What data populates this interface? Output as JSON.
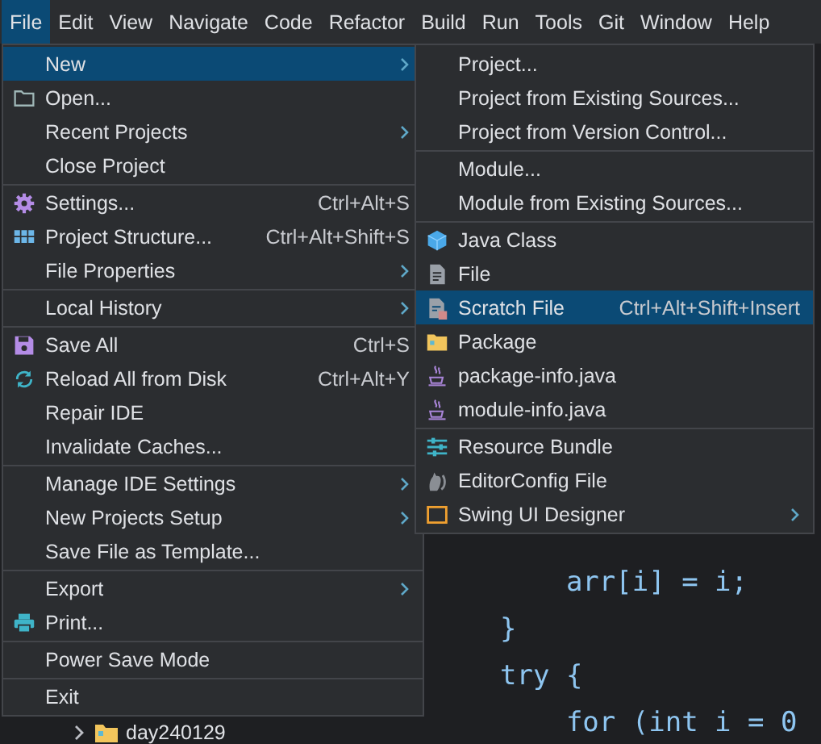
{
  "menubar": [
    {
      "label": "File",
      "selected": true
    },
    {
      "label": "Edit",
      "selected": false
    },
    {
      "label": "View",
      "selected": false
    },
    {
      "label": "Navigate",
      "selected": false
    },
    {
      "label": "Code",
      "selected": false
    },
    {
      "label": "Refactor",
      "selected": false
    },
    {
      "label": "Build",
      "selected": false
    },
    {
      "label": "Run",
      "selected": false
    },
    {
      "label": "Tools",
      "selected": false
    },
    {
      "label": "Git",
      "selected": false
    },
    {
      "label": "Window",
      "selected": false
    },
    {
      "label": "Help",
      "selected": false
    }
  ],
  "file_menu": {
    "groups": [
      {
        "items": [
          {
            "label": "New",
            "submenu": true,
            "selected": true
          },
          {
            "label": "Open...",
            "submenu": false,
            "selected": false
          },
          {
            "label": "Recent Projects",
            "submenu": true,
            "selected": false
          },
          {
            "label": "Close Project",
            "submenu": false,
            "selected": false
          }
        ]
      },
      {
        "items": [
          {
            "label": "Settings...",
            "shortcut": "Ctrl+Alt+S",
            "submenu": false,
            "selected": false
          },
          {
            "label": "Project Structure...",
            "shortcut": "Ctrl+Alt+Shift+S",
            "submenu": false,
            "selected": false
          },
          {
            "label": "File Properties",
            "submenu": true,
            "selected": false
          }
        ]
      },
      {
        "items": [
          {
            "label": "Local History",
            "submenu": true,
            "selected": false
          }
        ]
      },
      {
        "items": [
          {
            "label": "Save All",
            "shortcut": "Ctrl+S",
            "submenu": false,
            "selected": false
          },
          {
            "label": "Reload All from Disk",
            "shortcut": "Ctrl+Alt+Y",
            "submenu": false,
            "selected": false
          },
          {
            "label": "Repair IDE",
            "submenu": false,
            "selected": false
          },
          {
            "label": "Invalidate Caches...",
            "submenu": false,
            "selected": false
          }
        ]
      },
      {
        "items": [
          {
            "label": "Manage IDE Settings",
            "submenu": true,
            "selected": false
          },
          {
            "label": "New Projects Setup",
            "submenu": true,
            "selected": false
          },
          {
            "label": "Save File as Template...",
            "submenu": false,
            "selected": false
          }
        ]
      },
      {
        "items": [
          {
            "label": "Export",
            "submenu": true,
            "selected": false
          },
          {
            "label": "Print...",
            "submenu": false,
            "selected": false
          }
        ]
      },
      {
        "items": [
          {
            "label": "Power Save Mode",
            "submenu": false,
            "selected": false
          }
        ]
      },
      {
        "items": [
          {
            "label": "Exit",
            "submenu": false,
            "selected": false
          }
        ]
      }
    ]
  },
  "new_submenu": {
    "groups": [
      {
        "items": [
          {
            "label": "Project...",
            "submenu": false,
            "selected": false
          },
          {
            "label": "Project from Existing Sources...",
            "submenu": false,
            "selected": false
          },
          {
            "label": "Project from Version Control...",
            "submenu": false,
            "selected": false
          }
        ]
      },
      {
        "items": [
          {
            "label": "Module...",
            "submenu": false,
            "selected": false
          },
          {
            "label": "Module from Existing Sources...",
            "submenu": false,
            "selected": false
          }
        ]
      },
      {
        "items": [
          {
            "label": "Java Class",
            "submenu": false,
            "selected": false
          },
          {
            "label": "File",
            "submenu": false,
            "selected": false
          },
          {
            "label": "Scratch File",
            "shortcut": "Ctrl+Alt+Shift+Insert",
            "submenu": false,
            "selected": true
          },
          {
            "label": "Package",
            "submenu": false,
            "selected": false
          },
          {
            "label": "package-info.java",
            "submenu": false,
            "selected": false
          },
          {
            "label": "module-info.java",
            "submenu": false,
            "selected": false
          }
        ]
      },
      {
        "items": [
          {
            "label": "Resource Bundle",
            "submenu": false,
            "selected": false
          },
          {
            "label": "EditorConfig File",
            "submenu": false,
            "selected": false
          },
          {
            "label": "Swing UI Designer",
            "submenu": true,
            "selected": false
          }
        ]
      }
    ]
  },
  "project_tree": [
    {
      "label": "day240129",
      "expanded": false
    }
  ],
  "editor": {
    "lines": [
      "    arr[i] = i;",
      "}",
      "try {",
      "    for (int i = 0"
    ]
  }
}
